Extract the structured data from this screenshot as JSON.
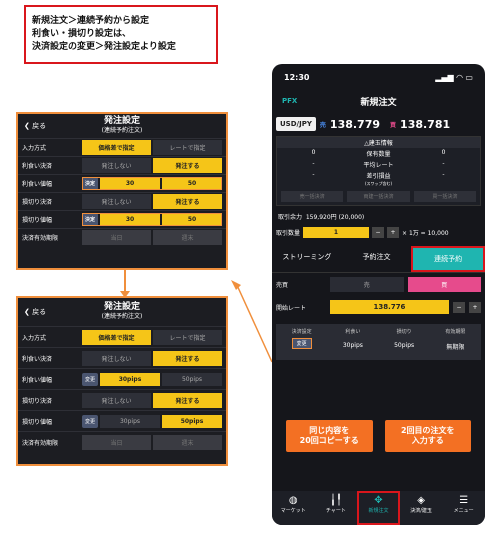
{
  "caption": {
    "lines": [
      "新規注文＞連続予約から設定",
      "利食い・損切り設定は、",
      "決済設定の変更＞発注設定より設定"
    ]
  },
  "phone": {
    "status_time": "12:30",
    "app_logo": "PFX",
    "header_title": "新規注文",
    "pair": "USD/JPY",
    "sell_label": "売",
    "buy_label": "買",
    "sell_price": "138.779",
    "buy_price": "138.781",
    "position_title": "△建玉情報",
    "position_rows": [
      {
        "a": "0",
        "b": "保有数量",
        "c": "0"
      },
      {
        "a": "-",
        "b": "平均レート",
        "c": "-"
      },
      {
        "a": "-",
        "b": "差引損益",
        "c": "-"
      }
    ],
    "swap_note": "(スワップ含む)",
    "position_buttons": [
      "売一括決済",
      "両建一括決済",
      "買一括決済"
    ],
    "margin_label": "取引余力",
    "margin_value": "159,920円 (20,000)",
    "qty_label": "取引数量",
    "qty_value": "1",
    "qty_minus": "−",
    "qty_plus": "+",
    "qty_unit": "× 1万 = 10,000",
    "tabs": [
      "ストリーミング",
      "予約注文",
      "連続予約"
    ],
    "side_label": "売買",
    "side_sell": "売",
    "side_buy": "買",
    "rate_label": "開始レート",
    "rate_value": "138.776",
    "rate_minus": "−",
    "rate_plus": "+",
    "settings": [
      {
        "k": "決済設定",
        "v": "変更"
      },
      {
        "k": "利食い",
        "v": "30pips"
      },
      {
        "k": "損切り",
        "v": "50pips"
      },
      {
        "k": "有効期限",
        "v": "無期限"
      }
    ],
    "btn_copy": [
      "同じ内容を",
      "20回コピーする"
    ],
    "btn_second": [
      "2回目の注文を",
      "入力する"
    ],
    "nav": [
      {
        "icon": "globe-icon",
        "label": "マーケット"
      },
      {
        "icon": "chart-icon",
        "label": "チャート"
      },
      {
        "icon": "new-order-icon",
        "label": "新規注文"
      },
      {
        "icon": "layers-icon",
        "label": "決済/建玉"
      },
      {
        "icon": "menu-icon",
        "label": "メニュー"
      }
    ]
  },
  "panel_common": {
    "back": "戻る",
    "title": "発注設定",
    "subtitle": "(連続予約注文)",
    "row_labels": [
      "入力方式",
      "利食い決済",
      "利食い値幅",
      "損切り決済",
      "損切り値幅",
      "決済有効期限"
    ],
    "method_a": "価格差で指定",
    "method_b": "レートで指定",
    "off": "発注しない",
    "on": "発注する",
    "expiry_a": "当日",
    "expiry_b": "週末"
  },
  "panel1": {
    "badge": "決定",
    "tp1": "30",
    "tp2": "50",
    "sl1": "30",
    "sl2": "50"
  },
  "panel2": {
    "badge": "変更",
    "tp1": "30pips",
    "tp2": "50pips",
    "sl1": "30pips",
    "sl2": "50pips"
  },
  "colors": {
    "accent": "#f08f3c",
    "yellow": "#f5c518",
    "teal": "#1fb5b0",
    "red": "#d9161c",
    "buy": "#e64b8c",
    "orange_btn": "#f37023"
  }
}
